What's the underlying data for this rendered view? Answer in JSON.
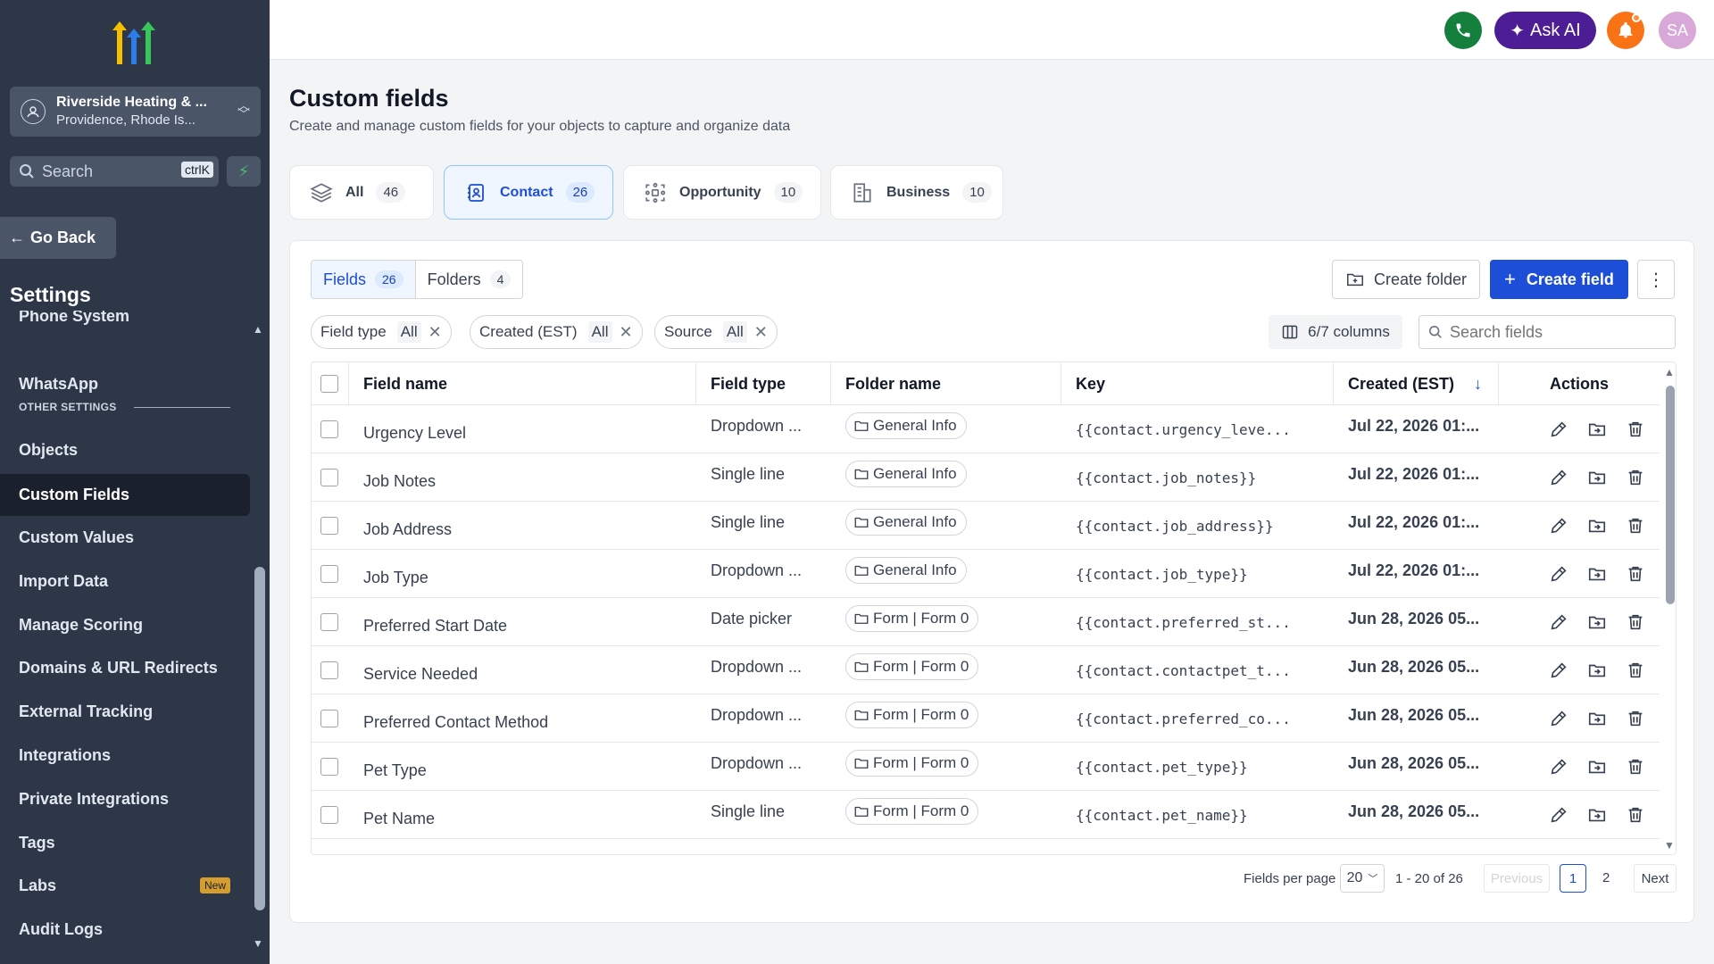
{
  "sidebar": {
    "account_name": "Riverside Heating & ...",
    "account_location": "Providence, Rhode Is...",
    "search_placeholder": "Search",
    "search_shortcut": "ctrlK",
    "go_back": "Go Back",
    "title": "Settings",
    "items": [
      {
        "label": "Phone System"
      },
      {
        "label": "WhatsApp"
      },
      {
        "section": "OTHER SETTINGS"
      },
      {
        "label": "Objects"
      },
      {
        "label": "Custom Fields",
        "active": true
      },
      {
        "label": "Custom Values"
      },
      {
        "label": "Import Data"
      },
      {
        "label": "Manage Scoring"
      },
      {
        "label": "Domains & URL Redirects"
      },
      {
        "label": "External Tracking"
      },
      {
        "label": "Integrations"
      },
      {
        "label": "Private Integrations"
      },
      {
        "label": "Tags"
      },
      {
        "label": "Labs",
        "badge": "New"
      },
      {
        "label": "Audit Logs"
      }
    ]
  },
  "topbar": {
    "ask_ai": "Ask AI",
    "avatar_initials": "SA"
  },
  "page": {
    "title": "Custom fields",
    "subtitle": "Create and manage custom fields for your objects to capture and organize data"
  },
  "object_tabs": [
    {
      "label": "All",
      "count": "46",
      "icon": "layers-icon"
    },
    {
      "label": "Contact",
      "count": "26",
      "icon": "contact-book-icon",
      "active": true
    },
    {
      "label": "Opportunity",
      "count": "10",
      "icon": "target-icon"
    },
    {
      "label": "Business",
      "count": "10",
      "icon": "building-icon"
    }
  ],
  "segments": [
    {
      "label": "Fields",
      "count": "26",
      "active": true
    },
    {
      "label": "Folders",
      "count": "4"
    }
  ],
  "toolbar": {
    "create_folder": "Create folder",
    "create_field": "Create field",
    "columns": "6/7 columns",
    "search_placeholder": "Search fields"
  },
  "filters": [
    {
      "label": "Field type",
      "value": "All"
    },
    {
      "label": "Created (EST)",
      "value": "All"
    },
    {
      "label": "Source",
      "value": "All"
    }
  ],
  "table": {
    "headers": {
      "field_name": "Field name",
      "field_type": "Field type",
      "folder_name": "Folder name",
      "key": "Key",
      "created": "Created (EST)",
      "actions": "Actions"
    },
    "rows": [
      {
        "name": "Urgency Level",
        "type": "Dropdown ...",
        "folder": "General Info",
        "key": "{{contact.urgency_leve...",
        "created": "Jul 22, 2026 01:..."
      },
      {
        "name": "Job Notes",
        "type": "Single line",
        "folder": "General Info",
        "key": "{{contact.job_notes}}",
        "created": "Jul 22, 2026 01:..."
      },
      {
        "name": "Job Address",
        "type": "Single line",
        "folder": "General Info",
        "key": "{{contact.job_address}}",
        "created": "Jul 22, 2026 01:..."
      },
      {
        "name": "Job Type",
        "type": "Dropdown ...",
        "folder": "General Info",
        "key": "{{contact.job_type}}",
        "created": "Jul 22, 2026 01:..."
      },
      {
        "name": "Preferred Start Date",
        "type": "Date picker",
        "folder": "Form | Form 0",
        "key": "{{contact.preferred_st...",
        "created": "Jun 28, 2026 05..."
      },
      {
        "name": "Service Needed",
        "type": "Dropdown ...",
        "folder": "Form | Form 0",
        "key": "{{contact.contactpet_t...",
        "created": "Jun 28, 2026 05..."
      },
      {
        "name": "Preferred Contact Method",
        "type": "Dropdown ...",
        "folder": "Form | Form 0",
        "key": "{{contact.preferred_co...",
        "created": "Jun 28, 2026 05..."
      },
      {
        "name": "Pet Type",
        "type": "Dropdown ...",
        "folder": "Form | Form 0",
        "key": "{{contact.pet_type}}",
        "created": "Jun 28, 2026 05..."
      },
      {
        "name": "Pet Name",
        "type": "Single line",
        "folder": "Form | Form 0",
        "key": "{{contact.pet_name}}",
        "created": "Jun 28, 2026 05..."
      }
    ]
  },
  "pagination": {
    "per_page_label": "Fields per page",
    "per_page": "20",
    "range": "1 - 20 of 26",
    "previous": "Previous",
    "pages": [
      "1",
      "2"
    ],
    "next": "Next"
  },
  "colors": {
    "sidebar_bg": "#2d3748",
    "primary": "#1d4ed8",
    "phone_green": "#15803d",
    "ai_purple": "#4c1d95",
    "bell_orange": "#f97316"
  }
}
